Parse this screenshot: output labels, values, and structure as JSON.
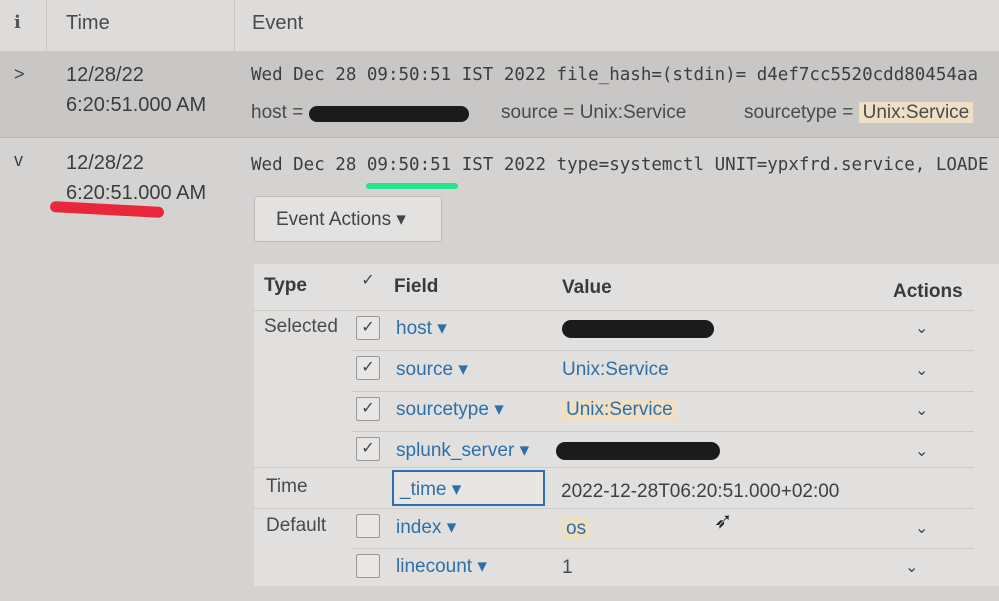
{
  "header": {
    "info_icon": "i",
    "time_label": "Time",
    "event_label": "Event"
  },
  "events": [
    {
      "expander": ">",
      "date": "12/28/22",
      "time": "6:20:51.000 AM",
      "raw": "Wed Dec 28 09:50:51 IST 2022 file_hash=(stdin)= d4ef7cc5520cdd80454aa",
      "meta": {
        "host_label": "host =",
        "source_label": "source =",
        "source_value": "Unix:Service",
        "sourcetype_label": "sourcetype =",
        "sourcetype_value": "Unix:Service"
      }
    },
    {
      "expander": "v",
      "date": "12/28/22",
      "time": "6:20:51.000 AM",
      "raw": "Wed Dec 28 09:50:51 IST 2022 type=systemctl UNIT=ypxfrd.service, LOADE"
    }
  ],
  "event_actions_label": "Event Actions",
  "fields_table": {
    "headers": {
      "type": "Type",
      "field": "Field",
      "value": "Value",
      "actions": "Actions"
    },
    "groups": {
      "selected": "Selected",
      "time": "Time",
      "default": "Default"
    },
    "rows": [
      {
        "field": "host",
        "value": ""
      },
      {
        "field": "source",
        "value": "Unix:Service"
      },
      {
        "field": "sourcetype",
        "value": "Unix:Service"
      },
      {
        "field": "splunk_server",
        "value": ""
      },
      {
        "field": "_time",
        "value": "2022-12-28T06:20:51.000+02:00"
      },
      {
        "field": "index",
        "value": "os"
      },
      {
        "field": "linecount",
        "value": "1"
      }
    ]
  },
  "icons": {
    "caret": "▾",
    "chevron": "⌄",
    "check": "✓"
  },
  "colors": {
    "link": "#2f6fa8",
    "red_annotation": "#e8283a",
    "green_annotation": "#29e28e",
    "focus_border": "#2b6fae"
  }
}
